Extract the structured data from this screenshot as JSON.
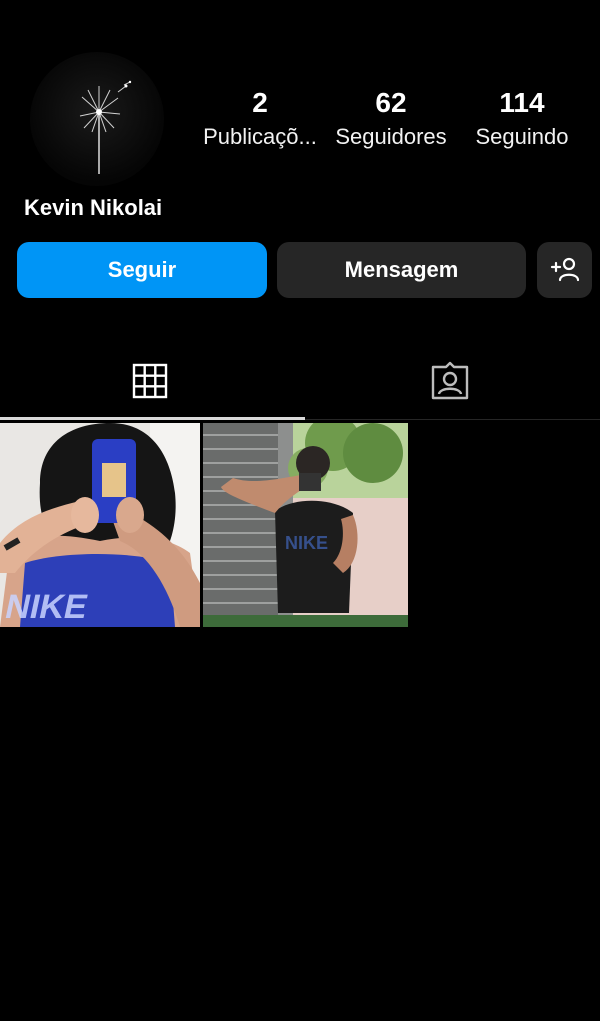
{
  "profile": {
    "username": "Kevin Nikolai",
    "stats": [
      {
        "count": "2",
        "label": "Publicaçõ..."
      },
      {
        "count": "62",
        "label": "Seguidores"
      },
      {
        "count": "114",
        "label": "Seguindo"
      }
    ]
  },
  "actions": {
    "follow_label": "Seguir",
    "message_label": "Mensagem",
    "add_icon": "person-add-icon"
  },
  "tabs": [
    {
      "icon": "grid-icon",
      "selected": true
    },
    {
      "icon": "tagged-icon",
      "selected": false
    }
  ],
  "posts": [
    {
      "type": "mirror-selfie-photo"
    },
    {
      "type": "mirror-selfie-photo"
    }
  ],
  "colors": {
    "background": "#000000",
    "primary_button": "#0095f6",
    "secondary_button": "#262626",
    "text": "#ffffff"
  }
}
